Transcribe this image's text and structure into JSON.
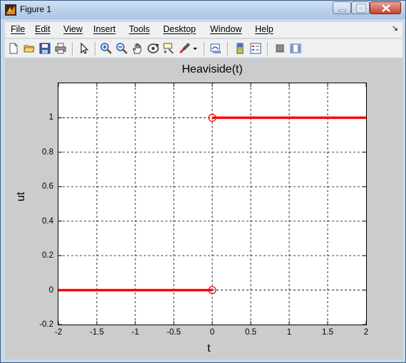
{
  "window": {
    "title": "Figure 1",
    "icons": {
      "app": "matlab-figure-icon",
      "minimize": "minimize-icon",
      "maximize": "maximize-icon",
      "close": "close-icon"
    }
  },
  "menubar": {
    "items": [
      "File",
      "Edit",
      "View",
      "Insert",
      "Tools",
      "Desktop",
      "Window",
      "Help"
    ],
    "overflow_icon": "menu-dock-arrow-icon"
  },
  "toolbar": {
    "buttons": [
      {
        "name": "new-figure",
        "icon": "new-file-icon"
      },
      {
        "name": "open-file",
        "icon": "open-folder-icon"
      },
      {
        "name": "save-figure",
        "icon": "save-disk-icon"
      },
      {
        "name": "print-figure",
        "icon": "printer-icon"
      },
      {
        "name": "edit-plot",
        "icon": "arrow-pointer-icon"
      },
      {
        "name": "zoom-in",
        "icon": "zoom-in-icon"
      },
      {
        "name": "zoom-out",
        "icon": "zoom-out-icon"
      },
      {
        "name": "pan",
        "icon": "hand-pan-icon"
      },
      {
        "name": "rotate-3d",
        "icon": "rotate-3d-icon"
      },
      {
        "name": "data-cursor",
        "icon": "data-cursor-icon"
      },
      {
        "name": "brush",
        "icon": "brush-icon"
      },
      {
        "name": "link-plot",
        "icon": "link-plot-icon"
      },
      {
        "name": "insert-colorbar",
        "icon": "colorbar-icon"
      },
      {
        "name": "insert-legend",
        "icon": "legend-icon"
      },
      {
        "name": "hide-plot-tools",
        "icon": "hide-tools-icon"
      },
      {
        "name": "show-plot-tools",
        "icon": "show-tools-icon"
      }
    ]
  },
  "chart_data": {
    "type": "line",
    "title": "Heaviside(t)",
    "xlabel": "t",
    "ylabel": "ut",
    "xlim": [
      -2,
      2
    ],
    "ylim": [
      -0.2,
      1.2
    ],
    "xticks": [
      -2,
      -1.5,
      -1,
      -0.5,
      0,
      0.5,
      1,
      1.5,
      2
    ],
    "xtick_labels": [
      "-2",
      "-1.5",
      "-1",
      "-0.5",
      "0",
      "0.5",
      "1",
      "1.5",
      "2"
    ],
    "yticks": [
      -0.2,
      0,
      0.2,
      0.4,
      0.6,
      0.8,
      1
    ],
    "ytick_labels": [
      "-0.2",
      "0",
      "0.2",
      "0.4",
      "0.6",
      "0.8",
      "1"
    ],
    "grid": true,
    "grid_style": "dashed",
    "series": [
      {
        "x": [
          -2,
          0
        ],
        "y": [
          0,
          0
        ],
        "color": "#ff0000"
      },
      {
        "x": [
          0,
          2
        ],
        "y": [
          1,
          1
        ],
        "color": "#ff0000"
      }
    ],
    "markers": [
      {
        "x": 0,
        "y": 0,
        "shape": "open-circle",
        "color": "#ff0000"
      },
      {
        "x": 0,
        "y": 1,
        "shape": "open-circle",
        "color": "#ff0000"
      }
    ]
  }
}
